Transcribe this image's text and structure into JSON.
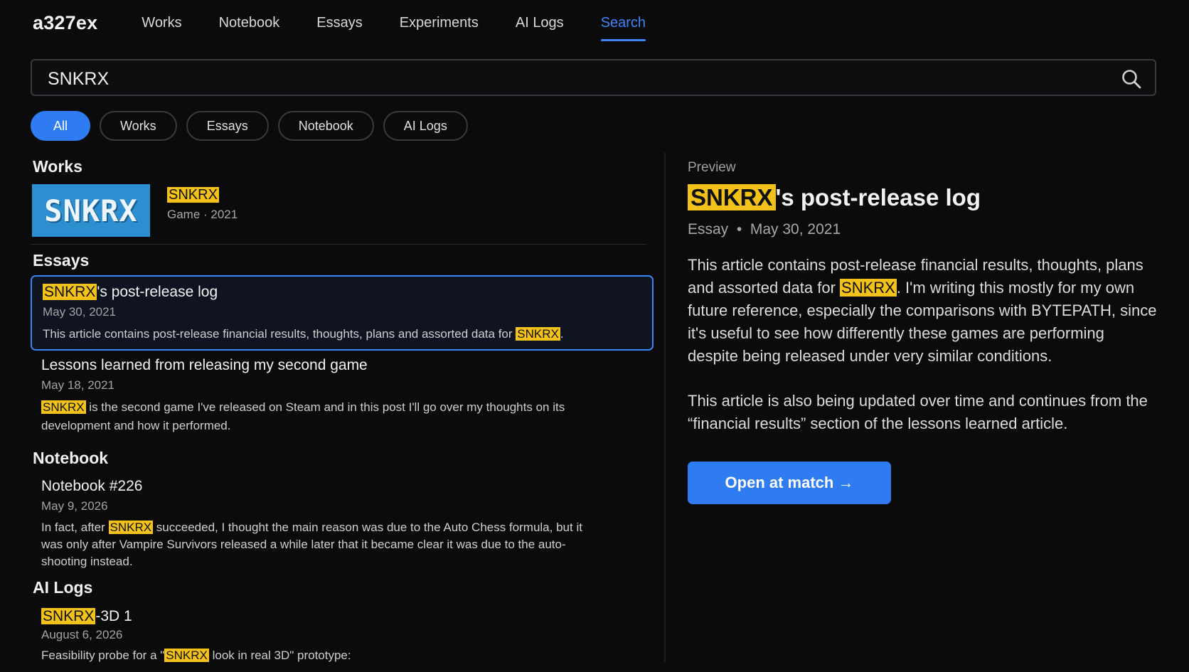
{
  "nav": {
    "brand": "a327ex",
    "items": [
      "Works",
      "Notebook",
      "Essays",
      "Experiments",
      "AI Logs",
      "Search"
    ],
    "active": "Search"
  },
  "search": {
    "value": "SNKRX"
  },
  "filters": [
    "All",
    "Works",
    "Essays",
    "Notebook",
    "AI Logs"
  ],
  "sections": {
    "works": "Works",
    "essays": "Essays",
    "notebook": "Notebook",
    "ailogs": "AI Logs"
  },
  "work": {
    "thumb_text": "SNKRX",
    "title": "SNKRX",
    "meta": "Game · 2021"
  },
  "essays": [
    {
      "title_hl": "SNKRX",
      "title_rest": "'s post-release log",
      "date": "May 30, 2021",
      "snip_pre": "This article contains post-release financial results, thoughts, plans and assorted data for ",
      "snip_hl": "SNKRX",
      "snip_post": "."
    },
    {
      "title": "Lessons learned from releasing my second game",
      "date": "May 18, 2021",
      "snip_hl": "SNKRX",
      "snip_post": " is the second game I've released on Steam and in this post I'll go over my thoughts on its development and how it performed."
    }
  ],
  "notebook": {
    "title": "Notebook #226",
    "date": "May 9, 2026",
    "snip_pre": "In fact, after ",
    "snip_hl": "SNKRX",
    "snip_post": " succeeded, I thought the main reason was due to the Auto Chess formula, but it was only after Vampire Survivors released a while later that it became clear it was due to the auto-shooting instead."
  },
  "ailog": {
    "title_hl": "SNKRX",
    "title_rest": "-3D 1",
    "date": "August 6, 2026",
    "snip_pre": "Feasibility probe for a \"",
    "snip_hl": "SNKRX",
    "snip_post": " look in real 3D\" prototype:"
  },
  "preview": {
    "label": "Preview",
    "title_hl": "SNKRX",
    "title_rest": "'s post-release log",
    "meta": "Essay  •  May 30, 2021",
    "p1_pre": "This article contains post-release financial results, thoughts, plans and assorted data for ",
    "p1_hl": "SNKRX",
    "p1_post": ". I'm writing this mostly for my own future reference, especially the comparisons with BYTEPATH, since it's useful to see how differently these games are performing despite being released under very similar conditions.",
    "p2": "This article is also being updated over time and continues from the “financial results” section of the lessons learned article.",
    "button": "Open at match →"
  },
  "colors": {
    "accent": "#2f7cf2",
    "highlight": "#f2c21b"
  }
}
